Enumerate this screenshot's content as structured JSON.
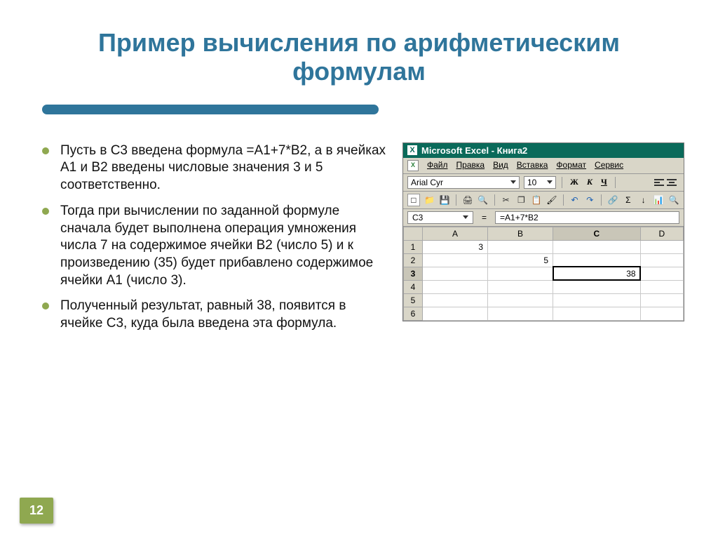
{
  "title": "Пример вычисления по арифметическим формулам",
  "page_number": "12",
  "bullets": [
    "Пусть в С3 введена формула =А1+7*В2, а в ячейках А1 и В2 введены числовые значения 3 и 5 соответственно.",
    "Тогда при вычислении по заданной формуле сначала будет выполнена операция умножения числа 7 на содержимое ячейки В2 (число 5) и к произведению (35) будет прибавлено содержимое ячейки А1 (число 3).",
    "Полученный результат, равный 38, появится в ячейке С3, куда была введена эта формула."
  ],
  "excel": {
    "window_title": "Microsoft Excel - Книга2",
    "menus": [
      "Файл",
      "Правка",
      "Вид",
      "Вставка",
      "Формат",
      "Сервис"
    ],
    "font_name": "Arial Cyr",
    "font_size": "10",
    "format_buttons": {
      "bold": "Ж",
      "italic": "К",
      "underline": "Ч"
    },
    "name_box": "C3",
    "formula_equals": "=",
    "formula": "=A1+7*B2",
    "col_headers": [
      "A",
      "B",
      "C",
      "D"
    ],
    "rows": [
      {
        "n": "1",
        "cells": [
          "3",
          "",
          "",
          ""
        ]
      },
      {
        "n": "2",
        "cells": [
          "",
          "5",
          "",
          ""
        ]
      },
      {
        "n": "3",
        "cells": [
          "",
          "",
          "38",
          ""
        ],
        "selected_col": 2
      },
      {
        "n": "4",
        "cells": [
          "",
          "",
          "",
          ""
        ]
      },
      {
        "n": "5",
        "cells": [
          "",
          "",
          "",
          ""
        ]
      },
      {
        "n": "6",
        "cells": [
          "",
          "",
          "",
          ""
        ]
      }
    ]
  },
  "colors": {
    "title": "#2f759b",
    "accent": "#8fa850",
    "excel_title": "#0a6a5a"
  }
}
